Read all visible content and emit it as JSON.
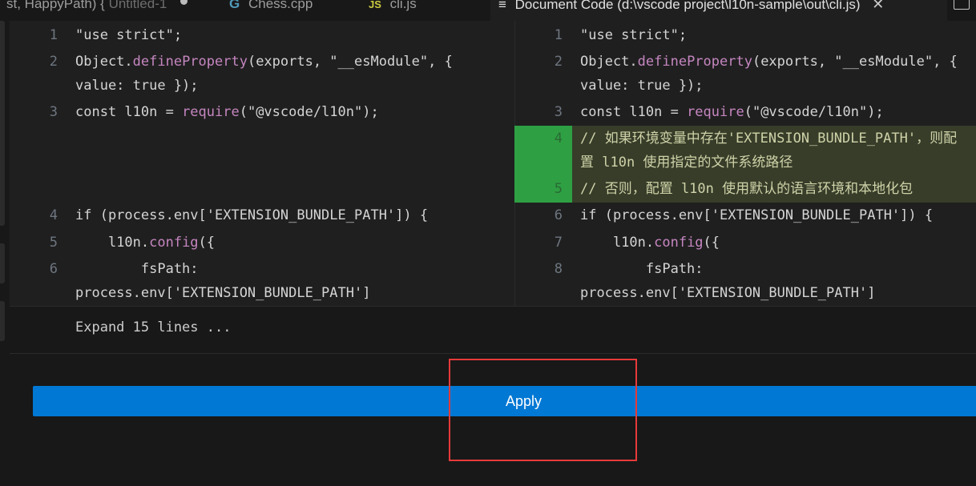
{
  "tabs": [
    {
      "label": "st, HappyPath) {",
      "suffix": "Untitled-1",
      "dirty": true,
      "icon": "none"
    },
    {
      "label": "Chess.cpp",
      "icon": "cpp-icon",
      "icon_glyph": "G"
    },
    {
      "label": "cli.js",
      "icon": "js-icon",
      "icon_glyph": "JS"
    },
    {
      "label": "Document Code (d:\\vscode project\\l10n-sample\\out\\cli.js)",
      "icon": "menu-icon",
      "icon_glyph": "≡",
      "active": true,
      "close_glyph": "✕"
    }
  ],
  "diff": {
    "left": {
      "lines": [
        {
          "n": "1",
          "text": "\"use strict\";"
        },
        {
          "n": "2",
          "text": "Object.defineProperty(exports, \"__esModule\", {"
        },
        {
          "n": "",
          "text": "value: true });"
        },
        {
          "n": "3",
          "text": "const l10n = require(\"@vscode/l10n\");"
        },
        {
          "n": "4",
          "text": "if (process.env['EXTENSION_BUNDLE_PATH']) {"
        },
        {
          "n": "5",
          "text": "    l10n.config({"
        },
        {
          "n": "6",
          "text": "        fsPath:"
        },
        {
          "n": "",
          "text": "process.env['EXTENSION_BUNDLE_PATH']"
        }
      ]
    },
    "right": {
      "lines": [
        {
          "n": "1",
          "text": "\"use strict\";"
        },
        {
          "n": "2",
          "text": "Object.defineProperty(exports, \"__esModule\", {"
        },
        {
          "n": "",
          "text": "value: true });"
        },
        {
          "n": "3",
          "text": "const l10n = require(\"@vscode/l10n\");"
        },
        {
          "n": "4",
          "text": "// 如果环境变量中存在'EXTENSION_BUNDLE_PATH'，则配"
        },
        {
          "n": "",
          "text": "置 l10n 使用指定的文件系统路径"
        },
        {
          "n": "5",
          "text": "// 否则，配置 l10n 使用默认的语言环境和本地化包"
        },
        {
          "n": "6",
          "text": "if (process.env['EXTENSION_BUNDLE_PATH']) {"
        },
        {
          "n": "7",
          "text": "    l10n.config({"
        },
        {
          "n": "8",
          "text": "        fsPath:"
        },
        {
          "n": "",
          "text": "process.env['EXTENSION_BUNDLE_PATH']"
        }
      ]
    }
  },
  "expand_label": "Expand 15 lines ...",
  "apply_label": "Apply",
  "colors": {
    "added_gutter": "#2ea043",
    "added_line": "#373d29",
    "apply_button": "#0078d4",
    "highlight": "#e63a3a"
  }
}
